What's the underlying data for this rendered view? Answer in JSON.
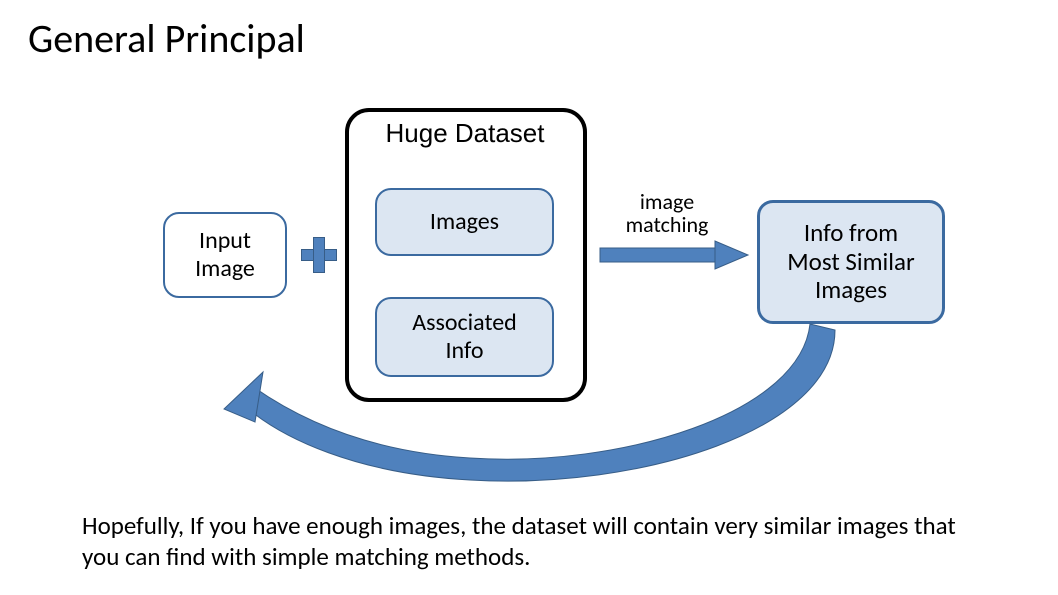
{
  "title": "General Principal",
  "input_box": "Input\nImage",
  "dataset_title": "Huge Dataset",
  "images_box": "Images",
  "assoc_box": "Associated\nInfo",
  "match_label": "image\nmatching",
  "info_box": "Info from\nMost Similar\nImages",
  "footer": "Hopefully,  If you have enough images, the dataset will contain very similar images that you can find with simple matching methods.",
  "colors": {
    "box_fill": "#dce6f2",
    "box_border": "#3b6aa0",
    "arrow": "#4f81bd",
    "arrow_stroke": "#375d87"
  }
}
